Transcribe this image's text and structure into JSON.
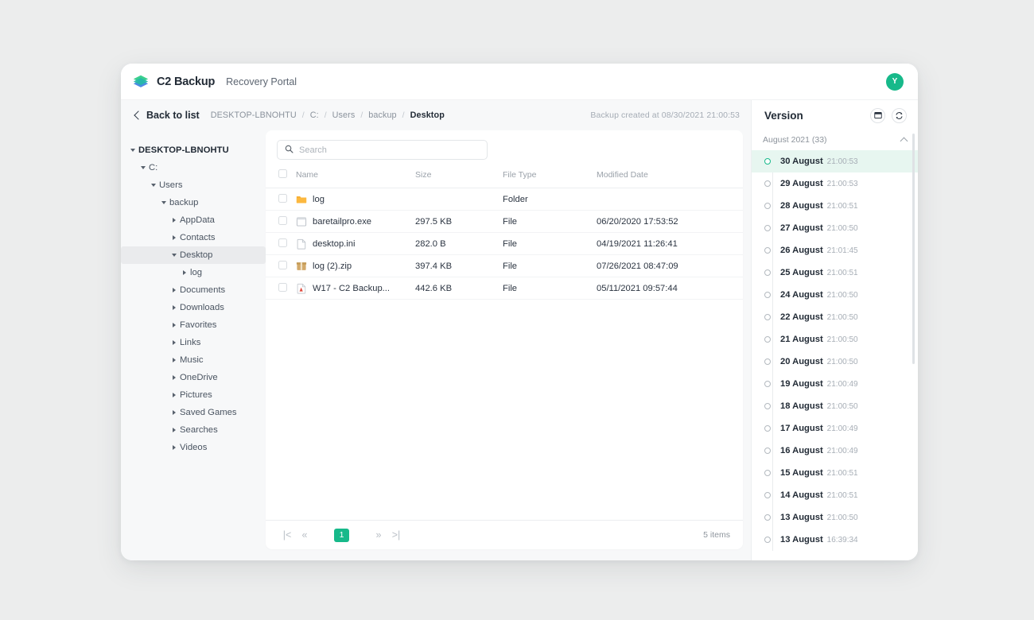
{
  "header": {
    "brand": "C2 Backup",
    "subtitle": "Recovery Portal",
    "logo_icon": "layers-icon",
    "avatar_initial": "Y",
    "accent_color": "#17b98a"
  },
  "breadcrumb_bar": {
    "back_label": "Back to list",
    "back_icon": "chevron-left-icon",
    "crumbs": [
      {
        "label": "DESKTOP-LBNOHTU",
        "current": false
      },
      {
        "label": "C:",
        "current": false
      },
      {
        "label": "Users",
        "current": false
      },
      {
        "label": "backup",
        "current": false
      },
      {
        "label": "Desktop",
        "current": true
      }
    ],
    "separator": "/",
    "backup_created": "Backup created at 08/30/2021 21:00:53"
  },
  "tree": [
    {
      "label": "DESKTOP-LBNOHTU",
      "depth": 0,
      "state": "down",
      "root": true,
      "selected": false
    },
    {
      "label": "C:",
      "depth": 1,
      "state": "down",
      "root": false,
      "selected": false
    },
    {
      "label": "Users",
      "depth": 2,
      "state": "down",
      "root": false,
      "selected": false
    },
    {
      "label": "backup",
      "depth": 3,
      "state": "down",
      "root": false,
      "selected": false
    },
    {
      "label": "AppData",
      "depth": 4,
      "state": "right",
      "root": false,
      "selected": false
    },
    {
      "label": "Contacts",
      "depth": 4,
      "state": "right",
      "root": false,
      "selected": false
    },
    {
      "label": "Desktop",
      "depth": 4,
      "state": "down",
      "root": false,
      "selected": true
    },
    {
      "label": "log",
      "depth": 5,
      "state": "right",
      "root": false,
      "selected": false
    },
    {
      "label": "Documents",
      "depth": 4,
      "state": "right",
      "root": false,
      "selected": false
    },
    {
      "label": "Downloads",
      "depth": 4,
      "state": "right",
      "root": false,
      "selected": false
    },
    {
      "label": "Favorites",
      "depth": 4,
      "state": "right",
      "root": false,
      "selected": false
    },
    {
      "label": "Links",
      "depth": 4,
      "state": "right",
      "root": false,
      "selected": false
    },
    {
      "label": "Music",
      "depth": 4,
      "state": "right",
      "root": false,
      "selected": false
    },
    {
      "label": "OneDrive",
      "depth": 4,
      "state": "right",
      "root": false,
      "selected": false
    },
    {
      "label": "Pictures",
      "depth": 4,
      "state": "right",
      "root": false,
      "selected": false
    },
    {
      "label": "Saved Games",
      "depth": 4,
      "state": "right",
      "root": false,
      "selected": false
    },
    {
      "label": "Searches",
      "depth": 4,
      "state": "right",
      "root": false,
      "selected": false
    },
    {
      "label": "Videos",
      "depth": 4,
      "state": "right",
      "root": false,
      "selected": false
    }
  ],
  "search": {
    "placeholder": "Search",
    "value": "",
    "icon": "search-icon"
  },
  "table": {
    "columns": [
      "Name",
      "Size",
      "File Type",
      "Modified Date"
    ],
    "rows": [
      {
        "icon": "folder-icon",
        "name": "log",
        "size": "",
        "type": "Folder",
        "modified": ""
      },
      {
        "icon": "exe-icon",
        "name": "baretailpro.exe",
        "size": "297.5 KB",
        "type": "File",
        "modified": "06/20/2020 17:53:52"
      },
      {
        "icon": "file-icon",
        "name": "desktop.ini",
        "size": "282.0 B",
        "type": "File",
        "modified": "04/19/2021 11:26:41"
      },
      {
        "icon": "zip-icon",
        "name": "log (2).zip",
        "size": "397.4 KB",
        "type": "File",
        "modified": "07/26/2021 08:47:09"
      },
      {
        "icon": "pdf-icon",
        "name": "W17 - C2 Backup...",
        "size": "442.6 KB",
        "type": "File",
        "modified": "05/11/2021 09:57:44"
      }
    ]
  },
  "pagination": {
    "first_icon": "|<",
    "prev_icon": "«",
    "current_page": "1",
    "next_icon": "»",
    "last_icon": ">|",
    "items_label": "5 items"
  },
  "version_panel": {
    "title": "Version",
    "calendar_icon": "calendar-icon",
    "refresh_icon": "refresh-icon",
    "month_group": "August 2021 (33)",
    "collapse_icon": "chevron-up-icon",
    "items": [
      {
        "date": "30 August",
        "time": "21:00:53",
        "active": true
      },
      {
        "date": "29 August",
        "time": "21:00:53",
        "active": false
      },
      {
        "date": "28 August",
        "time": "21:00:51",
        "active": false
      },
      {
        "date": "27 August",
        "time": "21:00:50",
        "active": false
      },
      {
        "date": "26 August",
        "time": "21:01:45",
        "active": false
      },
      {
        "date": "25 August",
        "time": "21:00:51",
        "active": false
      },
      {
        "date": "24 August",
        "time": "21:00:50",
        "active": false
      },
      {
        "date": "22 August",
        "time": "21:00:50",
        "active": false
      },
      {
        "date": "21 August",
        "time": "21:00:50",
        "active": false
      },
      {
        "date": "20 August",
        "time": "21:00:50",
        "active": false
      },
      {
        "date": "19 August",
        "time": "21:00:49",
        "active": false
      },
      {
        "date": "18 August",
        "time": "21:00:50",
        "active": false
      },
      {
        "date": "17 August",
        "time": "21:00:49",
        "active": false
      },
      {
        "date": "16 August",
        "time": "21:00:49",
        "active": false
      },
      {
        "date": "15 August",
        "time": "21:00:51",
        "active": false
      },
      {
        "date": "14 August",
        "time": "21:00:51",
        "active": false
      },
      {
        "date": "13 August",
        "time": "21:00:50",
        "active": false
      },
      {
        "date": "13 August",
        "time": "16:39:34",
        "active": false
      }
    ]
  }
}
